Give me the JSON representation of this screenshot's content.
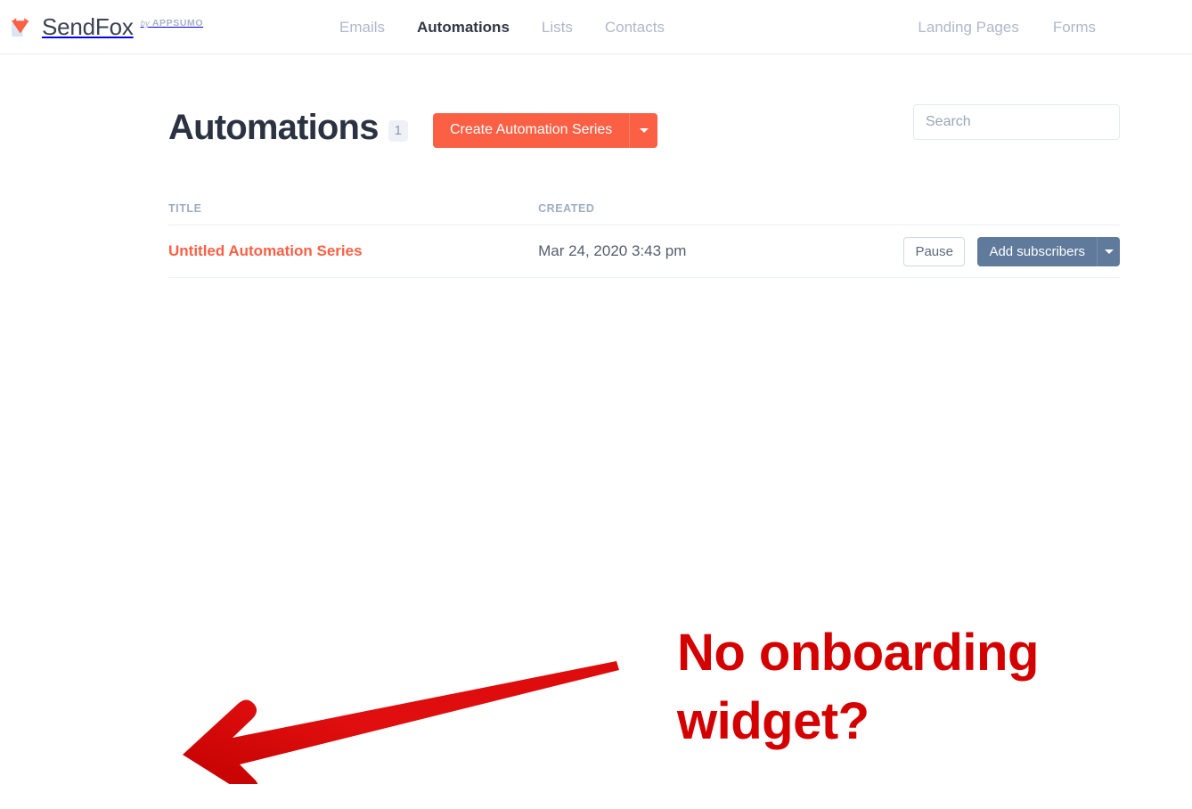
{
  "brand": {
    "name": "SendFox",
    "by": "by",
    "parent": "APPSUMO",
    "logo_icon": "sendfox-fox-envelope-icon"
  },
  "nav": {
    "center": [
      {
        "label": "Emails",
        "active": false
      },
      {
        "label": "Automations",
        "active": true
      },
      {
        "label": "Lists",
        "active": false
      },
      {
        "label": "Contacts",
        "active": false
      }
    ],
    "right": [
      {
        "label": "Landing Pages"
      },
      {
        "label": "Forms"
      }
    ]
  },
  "page": {
    "title": "Automations",
    "count": "1",
    "create_label": "Create Automation Series",
    "create_caret_icon": "chevron-down-icon"
  },
  "search": {
    "placeholder": "Search",
    "value": ""
  },
  "table": {
    "columns": [
      "TITLE",
      "CREATED",
      ""
    ],
    "rows": [
      {
        "title": "Untitled Automation Series",
        "created": "Mar 24, 2020 3:43 pm",
        "pause_label": "Pause",
        "add_subscribers_label": "Add subscribers",
        "add_subscribers_caret_icon": "chevron-down-icon"
      }
    ]
  },
  "annotation": {
    "text": "No onboarding widget?",
    "arrow_icon": "red-arrow-pointing-left-icon",
    "color": "#d40000"
  },
  "colors": {
    "accent": "#fb6045",
    "slate": "#5f7a9b",
    "nav_inactive": "#aeb8ca",
    "heading": "#2b3342",
    "annotation_red": "#d40000"
  }
}
